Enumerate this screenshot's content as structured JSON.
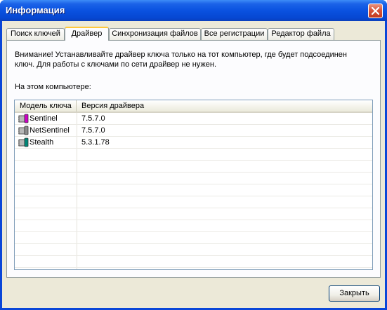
{
  "window": {
    "title": "Информация"
  },
  "tabs": [
    {
      "label": "Поиск ключей"
    },
    {
      "label": "Драйвер"
    },
    {
      "label": "Синхронизация файлов"
    },
    {
      "label": "Все регистрации"
    },
    {
      "label": "Редактор файла"
    }
  ],
  "active_tab": "Драйвер",
  "driver": {
    "notice_line1": "Внимание! Устанавливайте драйвер ключа только на тот компьютер, где будет подсоединен",
    "notice_line2": "ключ. Для работы с ключами по сети драйвер не нужен.",
    "section_label": "На этом компьютере:",
    "columns": [
      "Модель ключа",
      "Версия драйвера"
    ],
    "rows": [
      {
        "model": "Sentinel",
        "version": "7.5.7.0",
        "icon": "sentinel-key-icon",
        "icon_color": "#d000c8"
      },
      {
        "model": "NetSentinel",
        "version": "7.5.7.0",
        "icon": "netsentinel-key-icon",
        "icon_color": "#8c8c8c"
      },
      {
        "model": "Stealth",
        "version": "5.3.1.78",
        "icon": "stealth-key-icon",
        "icon_color": "#008878"
      }
    ]
  },
  "buttons": {
    "close": "Закрыть"
  }
}
